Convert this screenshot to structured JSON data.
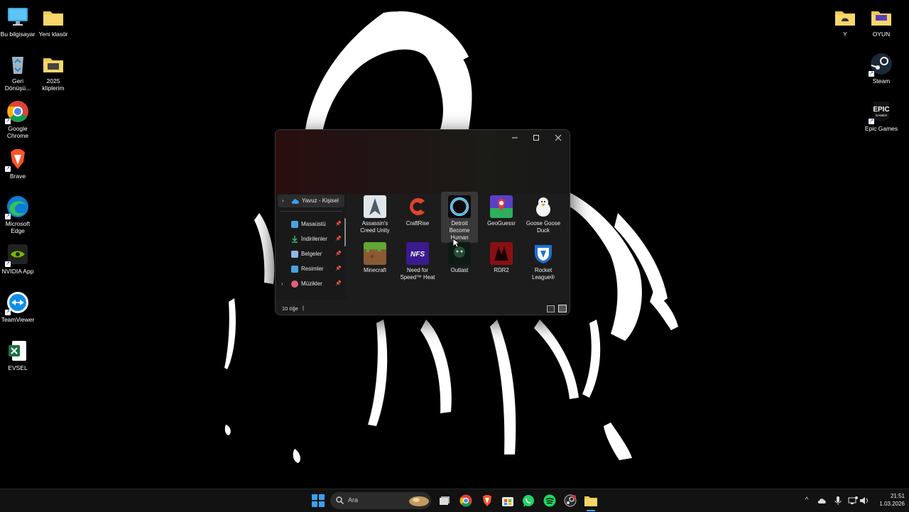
{
  "desktop_left": [
    {
      "label": "Bu bilgisayar",
      "icon": "monitor-icon"
    },
    {
      "label": "Yeni klasör",
      "icon": "folder-icon"
    },
    {
      "label": "Geri Dönüşü...",
      "icon": "recycle-bin-icon"
    },
    {
      "label": "2025 kliplerim",
      "icon": "folder-icon"
    },
    {
      "label": "Google Chrome",
      "icon": "chrome-icon"
    },
    {
      "label": "Brave",
      "icon": "brave-icon"
    },
    {
      "label": "Microsoft Edge",
      "icon": "edge-icon"
    },
    {
      "label": "NVIDIA App",
      "icon": "nvidia-icon"
    },
    {
      "label": "TeamViewer",
      "icon": "teamviewer-icon"
    },
    {
      "label": "EVSEL",
      "icon": "excel-icon"
    }
  ],
  "desktop_right": [
    {
      "label": "Y",
      "icon": "folder-icon"
    },
    {
      "label": "OYUN",
      "icon": "folder-icon"
    },
    {
      "label": "Steam",
      "icon": "steam-icon"
    },
    {
      "label": "Epic Games",
      "icon": "epic-games-icon",
      "logo_text": "EPIC GAMES"
    }
  ],
  "explorer": {
    "sidebar": {
      "onedrive": "Yavuz - Kişisel",
      "items": [
        {
          "label": "Masaüstü",
          "color": "#4aa3df"
        },
        {
          "label": "İndirilenler",
          "color": "#2eb872"
        },
        {
          "label": "Belgeler",
          "color": "#8fb7e6"
        },
        {
          "label": "Resimler",
          "color": "#49a3e0"
        },
        {
          "label": "Müzikler",
          "color": "#e0607a"
        }
      ]
    },
    "files": [
      {
        "label": "Assassin's Creed Unity",
        "icon": "assassins-creed-icon"
      },
      {
        "label": "CraftRise",
        "icon": "craftrise-icon"
      },
      {
        "label": "Detroit Become Human",
        "icon": "detroit-icon",
        "selected": true
      },
      {
        "label": "GeoGuessr",
        "icon": "geoguessr-icon"
      },
      {
        "label": "Goose Goose Duck",
        "icon": "goose-icon"
      },
      {
        "label": "Minecraft",
        "icon": "minecraft-icon"
      },
      {
        "label": "Need for Speed™ Heat",
        "icon": "nfs-icon",
        "logo_text": "NFS"
      },
      {
        "label": "Outlast",
        "icon": "outlast-icon"
      },
      {
        "label": "RDR2",
        "icon": "rdr2-icon"
      },
      {
        "label": "Rocket League®",
        "icon": "rocket-league-icon"
      }
    ],
    "status": "10 öğe",
    "status_separator": "|"
  },
  "taskbar": {
    "search_placeholder": "Ara",
    "time": "21:51",
    "date": "1.03.2026"
  },
  "colors": {
    "accent": "#0a84ff",
    "titlebar_red": "#2a0e0e",
    "folder": "#f3c94d"
  }
}
